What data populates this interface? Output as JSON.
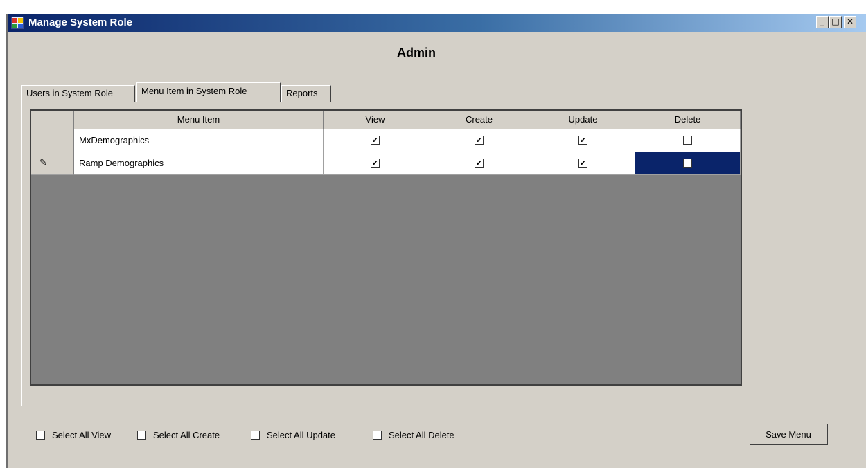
{
  "window": {
    "title": "Manage System Role",
    "controls": {
      "minimize": "_",
      "maximize": "□",
      "close": "✕"
    }
  },
  "heading": "Admin",
  "tabs": [
    {
      "label": "Users in System Role",
      "active": false
    },
    {
      "label": "Menu Item in System Role",
      "active": true
    },
    {
      "label": "Reports",
      "active": false
    }
  ],
  "grid": {
    "columns": [
      "Menu Item",
      "View",
      "Create",
      "Update",
      "Delete"
    ],
    "rows": [
      {
        "menu_item": "MxDemographics",
        "view": true,
        "create": true,
        "update": true,
        "delete": false,
        "editing": false
      },
      {
        "menu_item": "Ramp Demographics",
        "view": true,
        "create": true,
        "update": true,
        "delete": false,
        "editing": true,
        "selected_column": "delete"
      }
    ]
  },
  "bulk_selects": [
    {
      "label": "Select All View",
      "checked": false
    },
    {
      "label": "Select All Create",
      "checked": false
    },
    {
      "label": "Select All Update",
      "checked": false
    },
    {
      "label": "Select All Delete",
      "checked": false
    }
  ],
  "save_button": "Save Menu",
  "icons": {
    "app": "app-window-icon",
    "edit_row": "pencil-icon"
  },
  "colors": {
    "titlebar_start": "#0a246a",
    "titlebar_end": "#a6caf0",
    "dialog_bg": "#d4d0c8",
    "grid_empty_bg": "#808080",
    "selection": "#0a246a"
  }
}
